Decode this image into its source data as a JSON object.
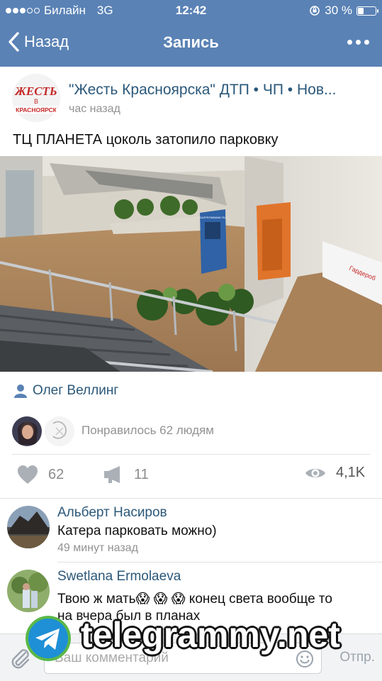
{
  "status": {
    "carrier": "Билайн",
    "network": "3G",
    "time": "12:42",
    "battery": "30 %",
    "battery_level": 0.3
  },
  "nav": {
    "back_label": "Назад",
    "title": "Запись"
  },
  "post": {
    "group_name": "\"Жесть Красноярска\" ДТП • ЧП • Нов...",
    "time": "час назад",
    "text": "ТЦ ПЛАНЕТА цоколь затопило парковку",
    "author": "Олег Веллинг",
    "likes_text": "Понравилось 62 людям",
    "photo_signs": {
      "atm": "GAZPROMBANK.RU",
      "cloakroom": "Гардероб"
    },
    "logo_text": [
      "ЖЕСТЬ",
      "В",
      "КРАСНОЯРСК"
    ]
  },
  "actions": {
    "likes": "62",
    "reposts": "11",
    "views": "4,1K"
  },
  "comments": [
    {
      "name": "Альберт Насиров",
      "text": "Катера парковать можно)",
      "time": "49 минут назад"
    },
    {
      "name": "Swetlana Ermolaeva",
      "text_line1": "Твою ж мать😱 😱 😱  конец света вообще то",
      "text_line2": "на вчера был в планах"
    }
  ],
  "input": {
    "placeholder": "Ваш комментарий",
    "send_label": "Отпр."
  },
  "watermark": "telegrammy.net",
  "colors": {
    "header": "#5a82b5",
    "link": "#2b587a",
    "muted": "#929292"
  }
}
